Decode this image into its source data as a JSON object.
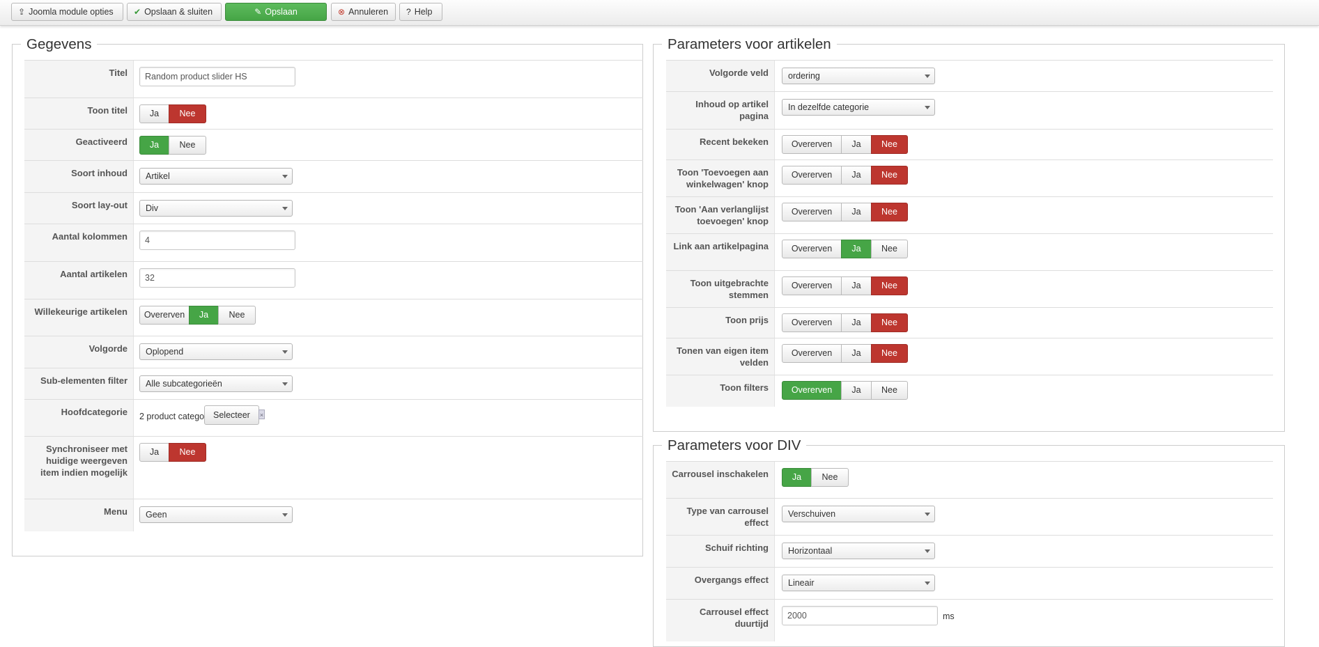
{
  "toolbar": {
    "module_options": "Joomla module opties",
    "save_close": "Opslaan & sluiten",
    "save": "Opslaan",
    "cancel": "Annuleren",
    "help": "Help"
  },
  "left": {
    "legend": "Gegevens",
    "title_label": "Titel",
    "title_value": "Random product slider HS",
    "show_title_label": "Toon titel",
    "show_title": {
      "yes": "Ja",
      "no": "Nee",
      "selected": "Nee"
    },
    "activated_label": "Geactiveerd",
    "activated": {
      "yes": "Ja",
      "no": "Nee",
      "selected": "Ja"
    },
    "content_type_label": "Soort inhoud",
    "content_type_value": "Artikel",
    "layout_type_label": "Soort lay-out",
    "layout_type_value": "Div",
    "columns_label": "Aantal kolommen",
    "columns_value": "4",
    "articles_label": "Aantal artikelen",
    "articles_value": "32",
    "random_label": "Willekeurige artikelen",
    "random": {
      "inherit": "Overerven",
      "yes": "Ja",
      "no": "Nee",
      "selected": "Ja"
    },
    "order_label": "Volgorde",
    "order_value": "Oplopend",
    "subfilter_label": "Sub-elementen filter",
    "subfilter_value": "Alle subcategorieën",
    "maincat_label": "Hoofdcategorie",
    "maincat_value": "2 product category",
    "maincat_button": "Selecteer",
    "sync_label": "Synchroniseer met huidige weergeven item indien mogelijk",
    "sync": {
      "yes": "Ja",
      "no": "Nee",
      "selected": "Nee"
    },
    "menu_label": "Menu",
    "menu_value": "Geen"
  },
  "right1": {
    "legend": "Parameters voor artikelen",
    "order_field_label": "Volgorde veld",
    "order_field_value": "ordering",
    "content_page_label": "Inhoud op artikel pagina",
    "content_page_value": "In dezelfde categorie",
    "recent_label": "Recent bekeken",
    "cart_label": "Toon 'Toevoegen aan winkelwagen' knop",
    "wishlist_label": "Toon 'Aan verlanglijst toevoegen' knop",
    "link_label": "Link aan artikelpagina",
    "votes_label": "Toon uitgebrachte stemmen",
    "price_label": "Toon prijs",
    "ownfields_label": "Tonen van eigen item velden",
    "filters_label": "Toon filters",
    "opt_inherit": "Overerven",
    "opt_yes": "Ja",
    "opt_no": "Nee",
    "selected": {
      "recent": "Nee",
      "cart": "Nee",
      "wishlist": "Nee",
      "link": "Ja",
      "votes": "Nee",
      "price": "Nee",
      "ownfields": "Nee",
      "filters": "Overerven"
    }
  },
  "right2": {
    "legend": "Parameters voor DIV",
    "carousel_label": "Carrousel inschakelen",
    "carousel": {
      "yes": "Ja",
      "no": "Nee",
      "selected": "Ja"
    },
    "effect_type_label": "Type van carrousel effect",
    "effect_type_value": "Verschuiven",
    "direction_label": "Schuif richting",
    "direction_value": "Horizontaal",
    "transition_label": "Overgangs effect",
    "transition_value": "Lineair",
    "duration_label": "Carrousel effect duurtijd",
    "duration_value": "2000",
    "duration_unit": "ms"
  },
  "colors": {
    "danger": "#bd362f",
    "success": "#46a546"
  }
}
